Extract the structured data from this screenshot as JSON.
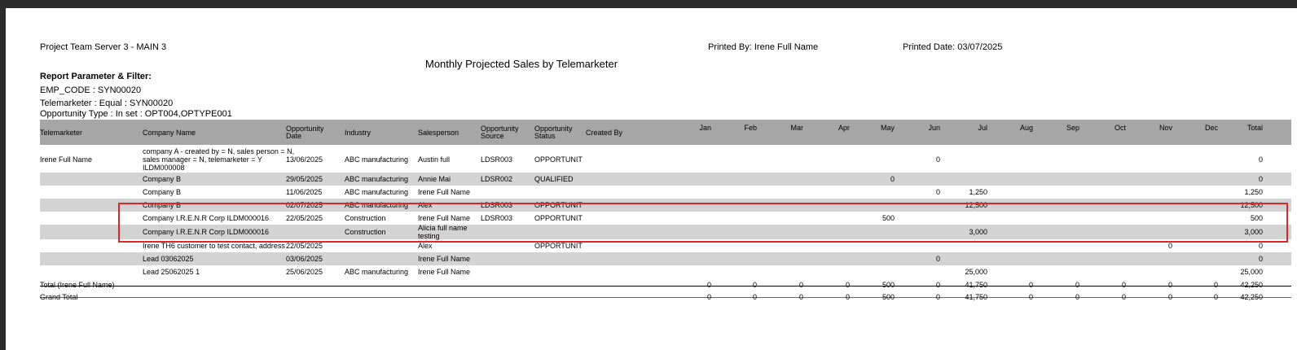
{
  "report": {
    "server": "Project Team Server 3 - MAIN 3",
    "printed_by": "Printed By: Irene Full Name",
    "printed_date": "Printed Date: 03/07/2025",
    "title": "Monthly Projected Sales by Telemarketer"
  },
  "filters": {
    "heading": "Report Parameter & Filter:",
    "lines": [
      "EMP_CODE : SYN00020",
      "Telemarketer : Equal : SYN00020",
      "Opportunity Type : In set : OPT004,OPTYPE001"
    ]
  },
  "columns": {
    "telemarketer": "Telemarketer",
    "company": "Company Name",
    "opp_date": [
      "Opportunity",
      "Date"
    ],
    "industry": "Industry",
    "salesperson": "Salesperson",
    "opp_source": [
      "Opportunity",
      "Source"
    ],
    "opp_status": [
      "Opportunity",
      "Status"
    ],
    "created_by": "Created By",
    "months": [
      "Jan",
      "Feb",
      "Mar",
      "Apr",
      "May",
      "Jun",
      "Jul",
      "Aug",
      "Sep",
      "Oct",
      "Nov",
      "Dec"
    ],
    "total": "Total"
  },
  "rows": [
    {
      "telemarketer": "Irene Full Name",
      "company": [
        "company A - created by = N, sales person = N,",
        "sales manager = N, telemarketer = Y",
        "ILDM000008"
      ],
      "date": "13/06/2025",
      "industry": "ABC manufacturing",
      "salesperson": [
        "Austin full"
      ],
      "source": "LDSR003",
      "status": "OPPORTUNIT",
      "months": [
        "",
        "",
        "",
        "",
        "",
        "0",
        "",
        "",
        "",
        "",
        "",
        ""
      ],
      "total": "0"
    },
    {
      "telemarketer": "",
      "company": [
        "Company B"
      ],
      "date": "29/05/2025",
      "industry": "ABC manufacturing",
      "salesperson": [
        "Annie Mai"
      ],
      "source": "LDSR002",
      "status": "QUALIFIED",
      "months": [
        "",
        "",
        "",
        "",
        "0",
        "",
        "",
        "",
        "",
        "",
        "",
        ""
      ],
      "total": "0"
    },
    {
      "telemarketer": "",
      "company": [
        "Company B"
      ],
      "date": "11/06/2025",
      "industry": "ABC manufacturing",
      "salesperson": [
        "Irene Full Name"
      ],
      "source": "",
      "status": "",
      "months": [
        "",
        "",
        "",
        "",
        "",
        "0",
        "1,250",
        "",
        "",
        "",
        "",
        ""
      ],
      "total": "1,250"
    },
    {
      "telemarketer": "",
      "company": [
        "Company B"
      ],
      "date": "02/07/2025",
      "industry": "ABC manufacturing",
      "salesperson": [
        "Alex"
      ],
      "source": "LDSR003",
      "status": "OPPORTUNIT",
      "months": [
        "",
        "",
        "",
        "",
        "",
        "",
        "12,500",
        "",
        "",
        "",
        "",
        ""
      ],
      "total": "12,500"
    },
    {
      "telemarketer": "",
      "company": [
        "Company I.R.E.N.R Corp ILDM000016"
      ],
      "date": "22/05/2025",
      "industry": "Construction",
      "salesperson": [
        "Irene Full Name"
      ],
      "source": "LDSR003",
      "status": "OPPORTUNIT",
      "months": [
        "",
        "",
        "",
        "",
        "500",
        "",
        "",
        "",
        "",
        "",
        "",
        ""
      ],
      "total": "500"
    },
    {
      "telemarketer": "",
      "company": [
        "Company I.R.E.N.R Corp ILDM000016"
      ],
      "date": "",
      "industry": "Construction",
      "salesperson": [
        "Alicia full name",
        "testing"
      ],
      "source": "",
      "status": "",
      "months": [
        "",
        "",
        "",
        "",
        "",
        "",
        "3,000",
        "",
        "",
        "",
        "",
        ""
      ],
      "total": "3,000"
    },
    {
      "telemarketer": "",
      "company": [
        "Irene TH6 customer to test contact, address"
      ],
      "date": "22/05/2025",
      "industry": "",
      "salesperson": [
        "Alex"
      ],
      "source": "",
      "status": "OPPORTUNIT",
      "months": [
        "",
        "",
        "",
        "",
        "",
        "",
        "",
        "",
        "",
        "",
        "0",
        ""
      ],
      "total": "0"
    },
    {
      "telemarketer": "",
      "company": [
        "Lead 03062025"
      ],
      "date": "03/06/2025",
      "industry": "",
      "salesperson": [
        "Irene Full Name"
      ],
      "source": "",
      "status": "",
      "months": [
        "",
        "",
        "",
        "",
        "",
        "0",
        "",
        "",
        "",
        "",
        "",
        ""
      ],
      "total": "0"
    },
    {
      "telemarketer": "",
      "company": [
        "Lead 25062025 1"
      ],
      "date": "25/06/2025",
      "industry": "ABC manufacturing",
      "salesperson": [
        "Irene Full Name"
      ],
      "source": "",
      "status": "",
      "months": [
        "",
        "",
        "",
        "",
        "",
        "",
        "25,000",
        "",
        "",
        "",
        "",
        ""
      ],
      "total": "25,000"
    }
  ],
  "totals": [
    {
      "label": "Total (Irene Full Name)",
      "months": [
        "0",
        "0",
        "0",
        "0",
        "500",
        "0",
        "41,750",
        "0",
        "0",
        "0",
        "0",
        "0"
      ],
      "total": "42,250"
    },
    {
      "label": "Grand Total",
      "months": [
        "0",
        "0",
        "0",
        "0",
        "500",
        "0",
        "41,750",
        "0",
        "0",
        "0",
        "0",
        "0"
      ],
      "total": "42,250"
    }
  ],
  "colors": {
    "header_bg": "#a6a6a6",
    "band_bg": "#d3d3d3",
    "highlight": "#e0262d",
    "frame": "#2b2b2b"
  }
}
